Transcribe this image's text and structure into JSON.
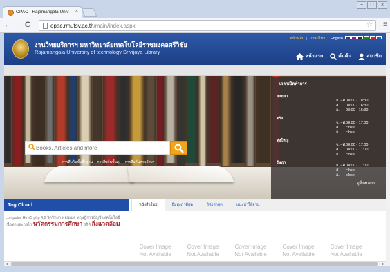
{
  "browser": {
    "tab_title": "OPAC : Rajamangala Univ",
    "tab_close": "×",
    "url_host": "opac.rmutsv.ac.th",
    "url_path": "/main/index.aspx",
    "back_icon": "←",
    "forward_icon": "→",
    "reload_icon": "C",
    "star_icon": "☆",
    "menu_icon": "≡",
    "win_min": "−",
    "win_max": "□",
    "win_close": "×"
  },
  "header": {
    "title_th": "งานวิทยบริการฯ มหาวิทยาลัยเทคโนโลยีราชมงคลศรีวิชัย",
    "title_en": "Rajamangala University of technology Srivijaya Library",
    "top_links": [
      "หน้าหลัก",
      "ภาษาไทย",
      "English"
    ],
    "swatch_colors": [
      "#1f3f8a",
      "#7a1f8c",
      "#2a2a2a",
      "#2f7d2a",
      "#c8282b",
      "#1565c0"
    ],
    "nav": [
      {
        "label": "หน้าแรก",
        "icon": "home-icon"
      },
      {
        "label": "ค้นค้น",
        "icon": "search-icon"
      },
      {
        "label": "สมาชิก",
        "icon": "user-icon"
      }
    ]
  },
  "search": {
    "placeholder": "Books, Articles and more",
    "links": [
      "การสืบค้นขั้นพื้นฐาน",
      "การสืบค้นขั้นสูง",
      "การสืบค้นตามอักษร"
    ]
  },
  "hours": {
    "title": "เวลาเปิดทำการ",
    "campuses": [
      {
        "name": "สงขลา",
        "rows": [
          {
            "day": "จ. - ศ.",
            "time": "08:00 - 18:30"
          },
          {
            "day": "ส.",
            "time": "08:00 - 16:30"
          },
          {
            "day": "อ.",
            "time": "08:00 - 16:30"
          }
        ]
      },
      {
        "name": "ตรัง",
        "rows": [
          {
            "day": "จ. - ศ.",
            "time": "08:00 - 17:00"
          },
          {
            "day": "ส.",
            "time": "close"
          },
          {
            "day": "อ.",
            "time": "close"
          }
        ]
      },
      {
        "name": "ทุ่งใหญ่",
        "rows": [
          {
            "day": "จ. - ศ.",
            "time": "08:00 - 17:00"
          },
          {
            "day": "ส.",
            "time": "08:00 - 17:00"
          },
          {
            "day": "อ.",
            "time": "close"
          }
        ]
      },
      {
        "name": "รัษฎา",
        "rows": [
          {
            "day": "จ. - ศ.",
            "time": "08:00 - 17:00"
          },
          {
            "day": "ส.",
            "time": "close"
          },
          {
            "day": "อ.",
            "time": "close"
          }
        ]
      }
    ],
    "more": "ดูทั้งหมด>>"
  },
  "tag_cloud": {
    "title": "Tag Cloud",
    "small": "computer Html5 php 4.2 วิดวิทยา ฟอนเนล ทฤษฎีการบัญชี เทคโนโลยีเนื้อหาและกลไก",
    "big1": "นวัตกรรมการศึกษา",
    "small2": "สถิติ",
    "big2": "สิ่งแวดล้อม"
  },
  "content_tabs": [
    "หนังสือใหม่",
    "ยืมสูงภาคีสุด",
    "วิจัยล่าสุด",
    "แนะนำให้อ่าน"
  ],
  "cover": {
    "line1": "Cover Image",
    "line2": "Not Available"
  },
  "cover_count": 5
}
